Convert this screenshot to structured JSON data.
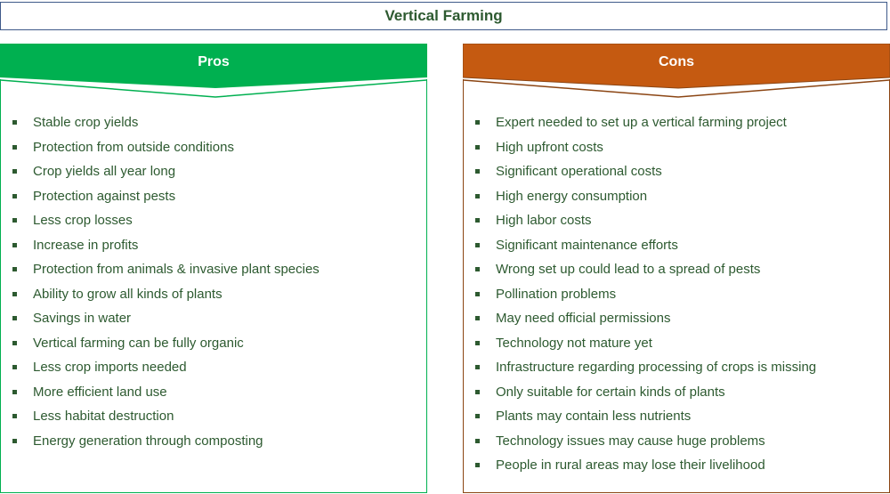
{
  "title": "Vertical Farming",
  "colors": {
    "pros_accent": "#00b050",
    "cons_accent": "#c55a11",
    "text": "#2d5a30",
    "title_border": "#3f5a8a"
  },
  "pros": {
    "label": "Pros",
    "items": [
      "Stable crop yields",
      "Protection from outside conditions",
      "Crop yields all year long",
      "Protection against pests",
      "Less crop losses",
      "Increase in profits",
      "Protection from animals & invasive plant species",
      "Ability to grow all kinds of plants",
      "Savings in water",
      "Vertical farming can be fully organic",
      "Less crop imports needed",
      "More efficient land use",
      "Less habitat destruction",
      "Energy generation through composting"
    ]
  },
  "cons": {
    "label": "Cons",
    "items": [
      "Expert needed to set up a vertical farming project",
      "High upfront costs",
      "Significant operational costs",
      "High energy consumption",
      "High labor costs",
      "Significant maintenance efforts",
      "Wrong set up could lead to a spread of pests",
      "Pollination problems",
      "May need official permissions",
      "Technology not mature yet",
      "Infrastructure regarding processing of crops is missing",
      "Only suitable for certain kinds of plants",
      "Plants may contain less nutrients",
      "Technology issues may cause huge problems",
      "People in rural areas may lose their livelihood"
    ]
  }
}
